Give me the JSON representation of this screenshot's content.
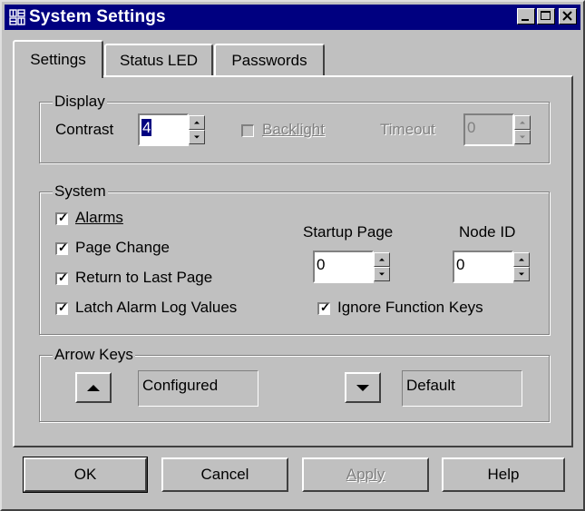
{
  "window": {
    "title": "System Settings"
  },
  "tabs": [
    {
      "label": "Settings",
      "active": true
    },
    {
      "label": "Status LED",
      "active": false
    },
    {
      "label": "Passwords",
      "active": false
    }
  ],
  "display": {
    "legend": "Display",
    "contrast_label": "Contrast",
    "contrast_value": "4",
    "backlight_label": "Backlight",
    "backlight_checked": false,
    "timeout_label": "Timeout",
    "timeout_value": "0"
  },
  "system": {
    "legend": "System",
    "alarms_label": "Alarms",
    "page_change_label": "Page Change",
    "return_last_label": "Return to Last Page",
    "latch_label": "Latch Alarm Log Values",
    "ignore_fn_label": "Ignore Function Keys",
    "startup_page_label": "Startup Page",
    "startup_page_value": "0",
    "node_id_label": "Node ID",
    "node_id_value": "0"
  },
  "arrow_keys": {
    "legend": "Arrow Keys",
    "up_value": "Configured",
    "down_value": "Default"
  },
  "buttons": {
    "ok": "OK",
    "cancel": "Cancel",
    "apply": "Apply",
    "help": "Help"
  }
}
